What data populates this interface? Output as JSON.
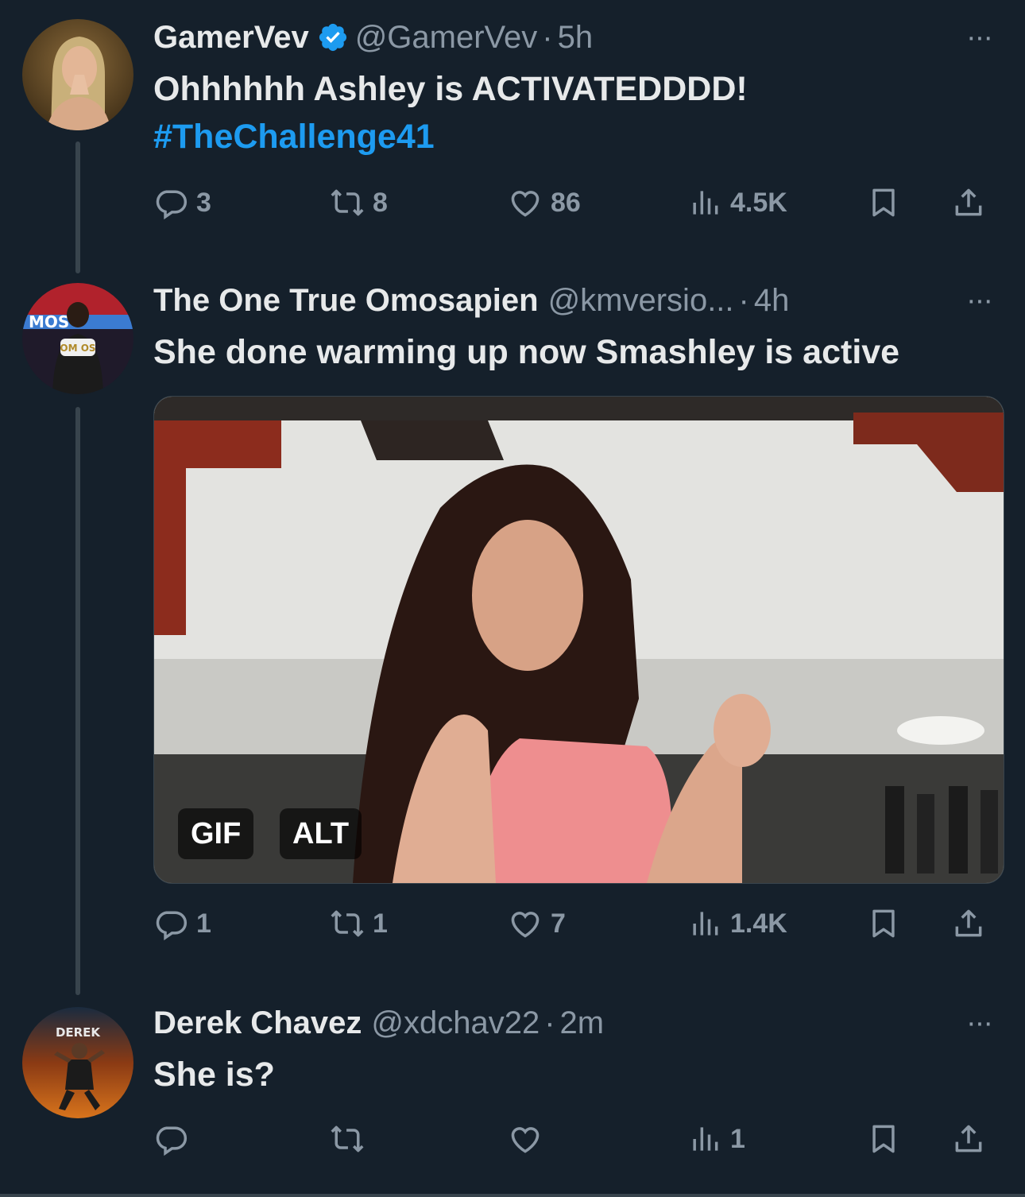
{
  "tweets": [
    {
      "name": "GamerVev",
      "verified": true,
      "handle": "@GamerVev",
      "time": "5h",
      "text": "Ohhhhhh Ashley is ACTIVATEDDDD!",
      "hashtag": "#TheChallenge41",
      "replies": "3",
      "retweets": "8",
      "likes": "86",
      "views": "4.5K"
    },
    {
      "name": "The One True Omosapien",
      "verified": false,
      "handle": "@kmversio...",
      "time": "4h",
      "text": "She done warming up now Smashley is active",
      "media": {
        "gif_label": "GIF",
        "alt_label": "ALT"
      },
      "replies": "1",
      "retweets": "1",
      "likes": "7",
      "views": "1.4K"
    },
    {
      "name": "Derek Chavez",
      "verified": false,
      "handle": "@xdchav22",
      "time": "2m",
      "text": "She is?",
      "avatar_text": "DEREK",
      "replies": "",
      "retweets": "",
      "likes": "",
      "views": "1"
    }
  ],
  "separator": "·",
  "more_label": "···",
  "colors": {
    "background": "#15202b",
    "accent": "#1d9bf0",
    "muted": "#8b98a5"
  }
}
